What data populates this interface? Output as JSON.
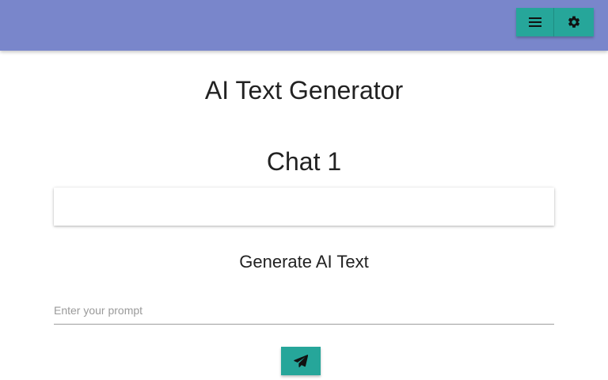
{
  "header": {
    "menu_icon": "menu-icon",
    "settings_icon": "gear-icon"
  },
  "main": {
    "title": "AI Text Generator",
    "chat_title": "Chat 1",
    "generate_title": "Generate AI Text",
    "prompt": {
      "value": "",
      "placeholder": "Enter your prompt"
    },
    "send_icon": "paper-plane-icon"
  },
  "colors": {
    "topbar": "#7986cb",
    "accent": "#26a69a"
  }
}
